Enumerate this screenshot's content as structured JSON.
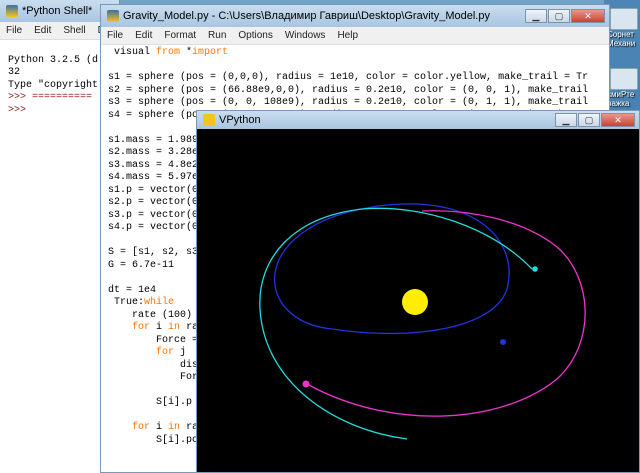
{
  "desktop": {
    "icons": [
      {
        "label": "Сорнет",
        "label2": "Механи"
      },
      {
        "label": "смиРте",
        "label2": "ражка"
      }
    ]
  },
  "shell": {
    "title": "*Python Shell*",
    "menu": [
      "File",
      "Edit",
      "Shell",
      "Debu"
    ],
    "lines": [
      "Python 3.2.5 (d",
      "32",
      "Type \"copyright",
      ">>> ==========",
      ">>>"
    ]
  },
  "editor": {
    "title": "Gravity_Model.py - C:\\Users\\Владимир Гавриш\\Desktop\\Gravity_Model.py",
    "menu": [
      "File",
      "Edit",
      "Format",
      "Run",
      "Options",
      "Windows",
      "Help"
    ],
    "code": [
      {
        "kw": "from",
        "a": " visual ",
        "kw2": "import",
        "b": " *"
      },
      {
        "a": ""
      },
      {
        "a": "s1 = sphere (pos = (0,0,0), radius = 1e10, color = color.yellow, make_trail = Tr"
      },
      {
        "a": "s2 = sphere (pos = (66.88e9,0,0), radius = 0.2e10, color = (0, 0, 1), make_trail"
      },
      {
        "a": "s3 = sphere (pos = (0, 0, 108e9), radius = 0.2e10, color = (0, 1, 1), make_trail"
      },
      {
        "a": "s4 = sphere (pos = (0, 0, -148e9), radius = 0.2e10, color = (1, 0.2, 1), make_tr"
      },
      {
        "a": ""
      },
      {
        "a": "s1.mass = 1.989"
      },
      {
        "a": "s2.mass = 3.28e"
      },
      {
        "a": "s3.mass = 4.8e2"
      },
      {
        "a": "s4.mass = 5.97e"
      },
      {
        "a": "s1.p = vector(0"
      },
      {
        "a": "s2.p = vector(0"
      },
      {
        "a": "s3.p = vector(0"
      },
      {
        "a": "s4.p = vector(0"
      },
      {
        "a": ""
      },
      {
        "a": "S = [s1, s2, s3"
      },
      {
        "a": "G = 6.7e-11"
      },
      {
        "a": ""
      },
      {
        "a": "dt = 1e4"
      },
      {
        "kw": "while",
        "a": " True:"
      },
      {
        "a": "    rate (100)"
      },
      {
        "a": "    ",
        "kw": "for",
        "b": " i ",
        "kw2": "in",
        "c": " ra"
      },
      {
        "a": "        Force ="
      },
      {
        "a": "        ",
        "kw": "for",
        "b": " j"
      },
      {
        "a": "            dis"
      },
      {
        "a": "            For"
      },
      {
        "a": ""
      },
      {
        "a": "        S[i].p "
      },
      {
        "a": ""
      },
      {
        "a": "    ",
        "kw": "for",
        "b": " i ",
        "kw2": "in",
        "c": " ra"
      },
      {
        "a": "        S[i].po"
      }
    ]
  },
  "vpython": {
    "title": "VPython"
  },
  "colors": {
    "sun": "#ffee00",
    "planet_blue": "#2233dd",
    "planet_cyan": "#22dddd",
    "planet_magenta": "#ee33cc"
  }
}
